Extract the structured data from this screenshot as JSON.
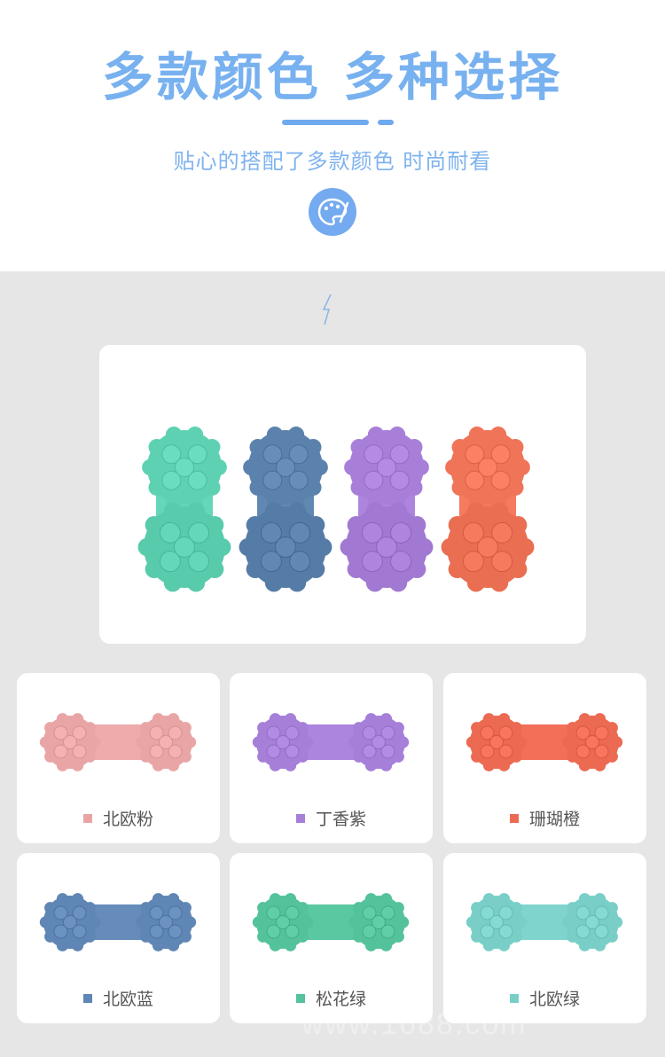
{
  "header": {
    "title": "多款颜色  多种选择",
    "subtitle": "贴心的搭配了多款颜色 时尚耐看",
    "icon": "palette-icon",
    "accent": "#78b1ef"
  },
  "hero": {
    "items": [
      {
        "color": "#5fd1b3"
      },
      {
        "color": "#5b82ad"
      },
      {
        "color": "#a77fd8"
      },
      {
        "color": "#ef7458"
      }
    ]
  },
  "colors": [
    {
      "label": "北欧粉",
      "color": "#e9a5a5"
    },
    {
      "label": "丁香紫",
      "color": "#a67fd9"
    },
    {
      "label": "珊瑚橙",
      "color": "#ec6a52"
    },
    {
      "label": "北欧蓝",
      "color": "#5f86b4"
    },
    {
      "label": "松花绿",
      "color": "#54c29a"
    },
    {
      "label": "北欧绿",
      "color": "#79cfc8"
    }
  ]
}
